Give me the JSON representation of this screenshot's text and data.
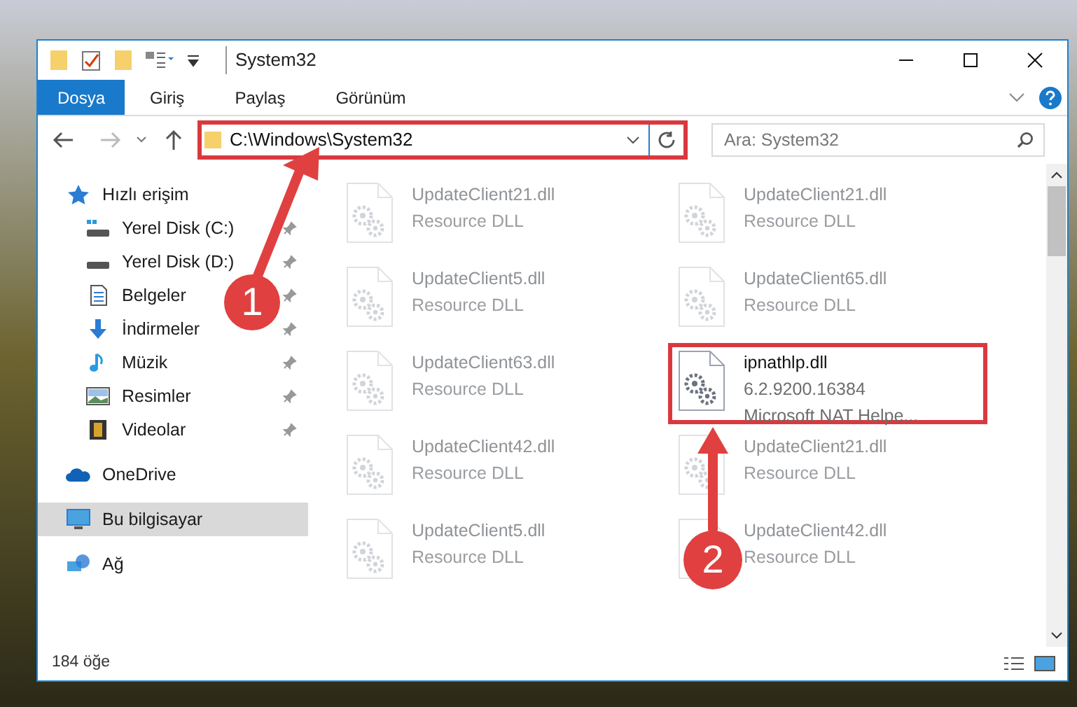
{
  "window": {
    "title": "System32"
  },
  "ribbon": {
    "tabs": [
      {
        "label": "Dosya",
        "selected": true
      },
      {
        "label": "Giriş",
        "selected": false
      },
      {
        "label": "Paylaş",
        "selected": false
      },
      {
        "label": "Görünüm",
        "selected": false
      }
    ]
  },
  "address_bar": {
    "path": "C:\\Windows\\System32",
    "highlighted": true
  },
  "search": {
    "placeholder": "Ara: System32"
  },
  "sidebar": {
    "items": [
      {
        "label": "Hızlı erişim",
        "kind": "star",
        "selected": false,
        "pinned": false,
        "children": [
          {
            "label": "Yerel Disk (C:)",
            "kind": "drive-c",
            "selected": false,
            "pinned": true
          },
          {
            "label": "Yerel Disk (D:)",
            "kind": "drive",
            "selected": false,
            "pinned": true
          },
          {
            "label": "Belgeler",
            "kind": "document",
            "selected": false,
            "pinned": true
          },
          {
            "label": "İndirmeler",
            "kind": "download",
            "selected": false,
            "pinned": true
          },
          {
            "label": "Müzik",
            "kind": "music",
            "selected": false,
            "pinned": true
          },
          {
            "label": "Resimler",
            "kind": "picture",
            "selected": false,
            "pinned": true
          },
          {
            "label": "Videolar",
            "kind": "film",
            "selected": false,
            "pinned": true
          }
        ]
      },
      {
        "label": "OneDrive",
        "kind": "cloud",
        "selected": false,
        "pinned": false
      },
      {
        "label": "Bu bilgisayar",
        "kind": "computer",
        "selected": true,
        "pinned": false
      },
      {
        "label": "Ağ",
        "kind": "network",
        "selected": false,
        "pinned": false
      }
    ]
  },
  "files": [
    {
      "name": "UpdateClient21.dll",
      "details": [
        "Resource DLL"
      ],
      "dimmed": true,
      "highlighted": false
    },
    {
      "name": "UpdateClient21.dll",
      "details": [
        "Resource DLL"
      ],
      "dimmed": true,
      "highlighted": false
    },
    {
      "name": "UpdateClient5.dll",
      "details": [
        "Resource DLL"
      ],
      "dimmed": true,
      "highlighted": false
    },
    {
      "name": "UpdateClient65.dll",
      "details": [
        "Resource DLL"
      ],
      "dimmed": true,
      "highlighted": false
    },
    {
      "name": "UpdateClient63.dll",
      "details": [
        "Resource DLL"
      ],
      "dimmed": true,
      "highlighted": false
    },
    {
      "name": "ipnathlp.dll",
      "details": [
        "6.2.9200.16384",
        "Microsoft NAT Helpe..."
      ],
      "dimmed": false,
      "highlighted": true
    },
    {
      "name": "UpdateClient42.dll",
      "details": [
        "Resource DLL"
      ],
      "dimmed": true,
      "highlighted": false
    },
    {
      "name": "UpdateClient21.dll",
      "details": [
        "Resource DLL"
      ],
      "dimmed": true,
      "highlighted": false
    },
    {
      "name": "UpdateClient5.dll",
      "details": [
        "Resource DLL"
      ],
      "dimmed": true,
      "highlighted": false
    },
    {
      "name": "UpdateClient42.dll",
      "details": [
        "Resource DLL"
      ],
      "dimmed": true,
      "highlighted": false
    }
  ],
  "status_bar": {
    "item_count": "184 öğe"
  },
  "callouts": [
    {
      "number": "1"
    },
    {
      "number": "2"
    }
  ]
}
